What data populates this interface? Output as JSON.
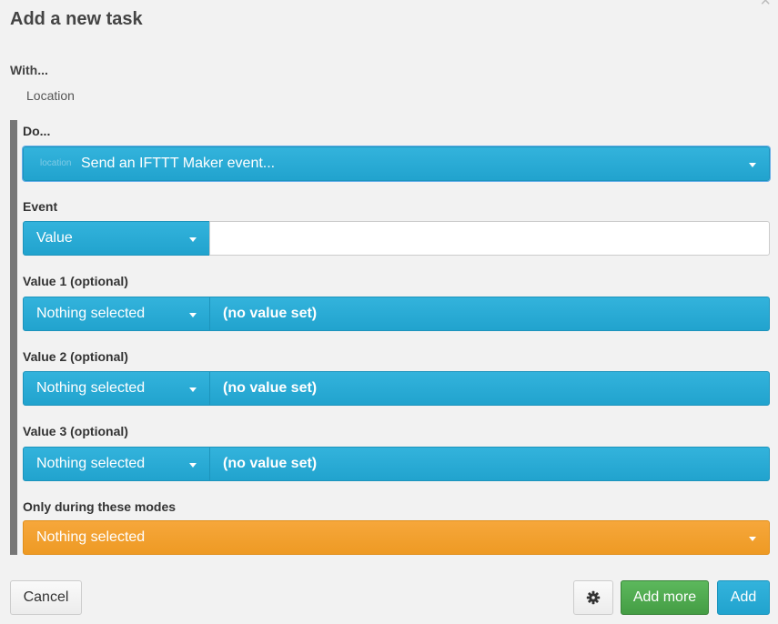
{
  "dialog": {
    "title": "Add a new task",
    "close_symbol": "×"
  },
  "with": {
    "label": "With...",
    "value": "Location"
  },
  "do": {
    "label": "Do...",
    "action_tag": "location",
    "action_value": "Send an IFTTT Maker event..."
  },
  "event": {
    "label": "Event",
    "type_value": "Value",
    "input_value": ""
  },
  "value1": {
    "label": "Value 1 (optional)",
    "select_value": "Nothing selected",
    "value_text": "(no value set)"
  },
  "value2": {
    "label": "Value 2 (optional)",
    "select_value": "Nothing selected",
    "value_text": "(no value set)"
  },
  "value3": {
    "label": "Value 3 (optional)",
    "select_value": "Nothing selected",
    "value_text": "(no value set)"
  },
  "modes": {
    "label": "Only during these modes",
    "select_value": "Nothing selected"
  },
  "footer": {
    "cancel_label": "Cancel",
    "settings_icon": "gear-icon",
    "add_more_label": "Add more",
    "add_label": "Add"
  },
  "colors": {
    "primary_blue": "#21a3ce",
    "mode_orange": "#ee9a24",
    "success_green": "#449d44"
  }
}
